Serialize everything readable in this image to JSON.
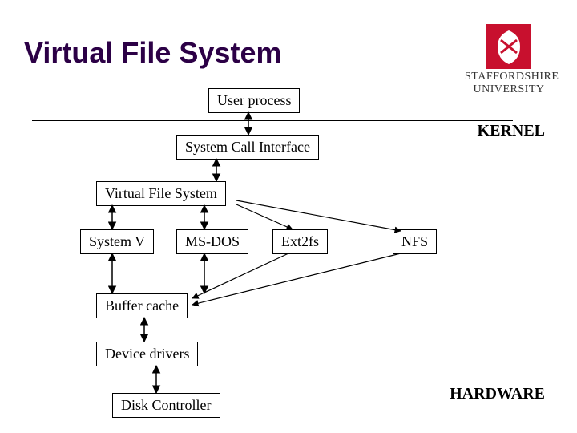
{
  "title": "Virtual File System",
  "logo": {
    "line1": "STAFFORDSHIRE",
    "line2": "UNIVERSITY"
  },
  "labels": {
    "kernel": "KERNEL",
    "hardware": "HARDWARE"
  },
  "nodes": {
    "user_process": "User process",
    "sci": "System Call Interface",
    "vfs": "Virtual File System",
    "sysv": "System V",
    "msdos": "MS-DOS",
    "ext2": "Ext2fs",
    "nfs": "NFS",
    "buffer": "Buffer cache",
    "drivers": "Device drivers",
    "disk": "Disk Controller"
  }
}
